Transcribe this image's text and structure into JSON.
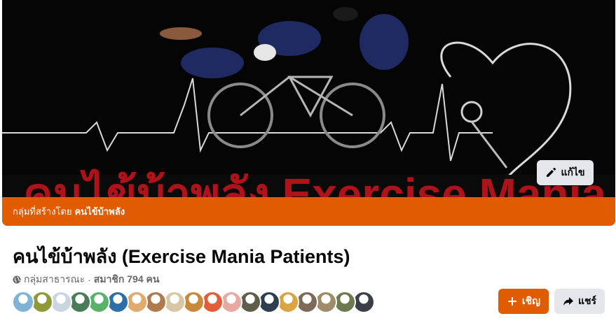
{
  "cover": {
    "edit_label": "แก้ไข",
    "watermark_text": "คนไข้บ้าพลัง Exercise Mania Patients"
  },
  "creator_bar": {
    "prefix": "กลุ่มที่สร้างโดย",
    "creator": "คนไข้บ้าพลัง"
  },
  "group": {
    "title": "คนไข้บ้าพลัง (Exercise Mania Patients)",
    "privacy": "กลุ่มสาธารณะ",
    "separator": "·",
    "members": "สมาชิก 794 คน"
  },
  "avatars": [
    {
      "color": "#7fb3d5"
    },
    {
      "color": "#8e9a3a"
    },
    {
      "color": "#c9d6df"
    },
    {
      "color": "#4a7c59"
    },
    {
      "color": "#58b368"
    },
    {
      "color": "#2e6fa7"
    },
    {
      "color": "#e0a96d"
    },
    {
      "color": "#b07a4f"
    },
    {
      "color": "#d9c6a5"
    },
    {
      "color": "#c88a3a"
    },
    {
      "color": "#e35d3a"
    },
    {
      "color": "#e7a9a2"
    },
    {
      "color": "#5e5e4a"
    },
    {
      "color": "#2c3e50"
    },
    {
      "color": "#d9a441"
    },
    {
      "color": "#7d6a58"
    },
    {
      "color": "#a08c6a"
    },
    {
      "color": "#6b7b4f"
    },
    {
      "color": "#3b3f47"
    }
  ],
  "actions": {
    "invite_label": "เชิญ",
    "share_label": "แชร์"
  },
  "colors": {
    "accent": "#e15b00",
    "secondary_button": "#e4e6eb",
    "muted_text": "#65676b"
  },
  "icons": {
    "edit": "pencil-icon",
    "privacy": "globe-icon",
    "invite": "plus-icon",
    "share": "share-arrow-icon"
  }
}
